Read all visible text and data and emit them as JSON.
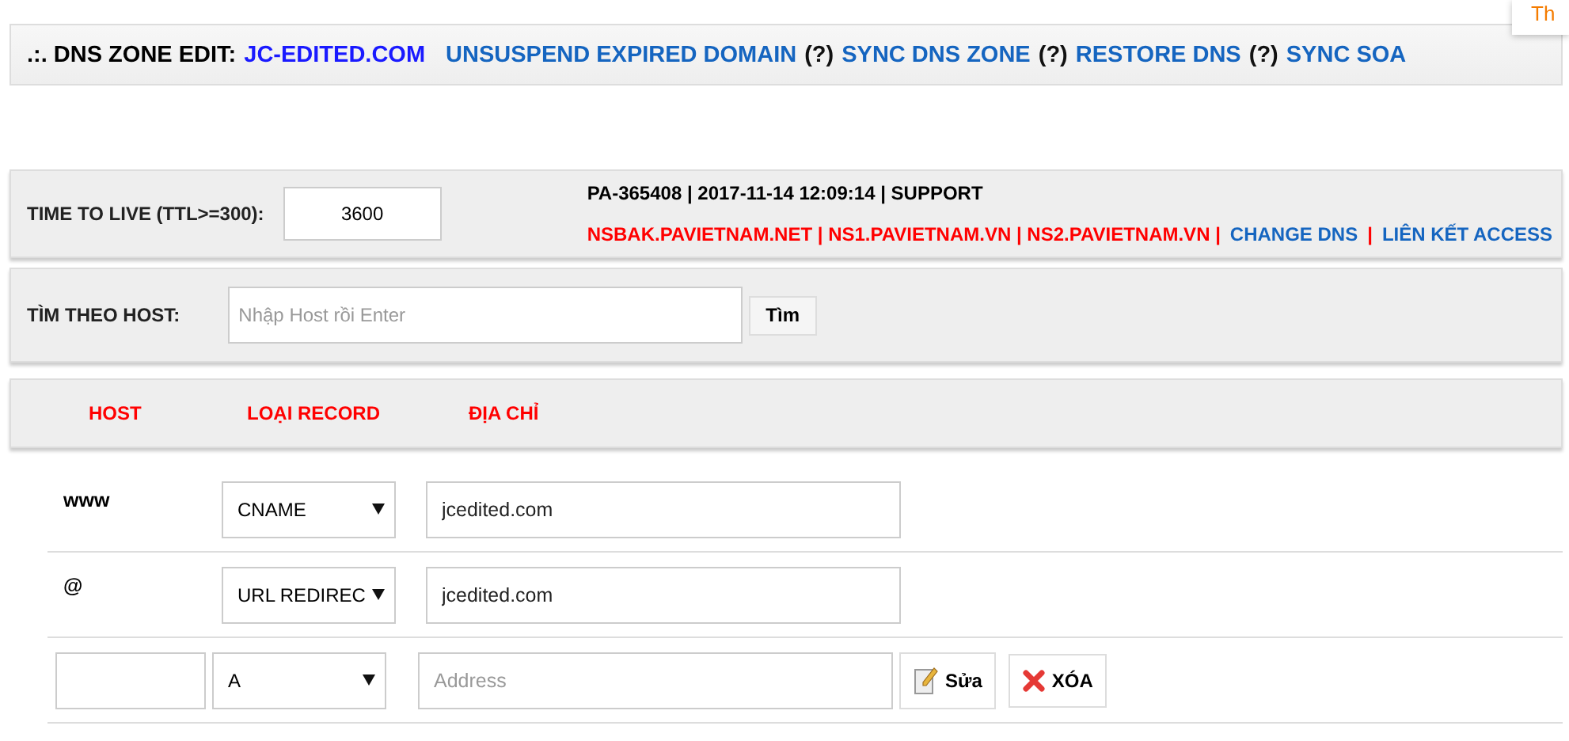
{
  "corner_tab": {
    "label": "Th"
  },
  "header": {
    "prefix": ".:. DNS ZONE EDIT:",
    "domain": "JC-EDITED.COM",
    "items": [
      {
        "kind": "link",
        "text": "UNSUSPEND EXPIRED DOMAIN"
      },
      {
        "kind": "help",
        "text": "(?)"
      },
      {
        "kind": "link",
        "text": "SYNC DNS ZONE"
      },
      {
        "kind": "help",
        "text": "(?)"
      },
      {
        "kind": "link",
        "text": "RESTORE DNS"
      },
      {
        "kind": "help",
        "text": "(?)"
      },
      {
        "kind": "link",
        "text": "SYNC SOA"
      }
    ]
  },
  "ttl": {
    "label": "TIME TO LIVE (TTL>=300):",
    "value": "3600",
    "info": "PA-365408 | 2017-11-14 12:09:14 | SUPPORT",
    "nameservers": "NSBAK.PAVIETNAM.NET | NS1.PAVIETNAM.VN | NS2.PAVIETNAM.VN |",
    "links": [
      {
        "kind": "link",
        "text": "CHANGE DNS"
      },
      {
        "kind": "sep",
        "text": "|"
      },
      {
        "kind": "link",
        "text": "LIÊN KẾT ACCESS"
      }
    ]
  },
  "search": {
    "label": "TÌM THEO HOST:",
    "placeholder": "Nhập Host rồi Enter",
    "button": "Tìm"
  },
  "columns": [
    "HOST",
    "LOẠI RECORD",
    "ĐỊA CHỈ"
  ],
  "records": [
    {
      "kind": "saved",
      "host": "www",
      "type": "CNAME",
      "address": "jcedited.com"
    },
    {
      "kind": "saved",
      "host": "@",
      "type": "URL REDIREC",
      "address": "jcedited.com"
    },
    {
      "kind": "new",
      "type": "A",
      "address_placeholder": "Address",
      "edit_button": "Sửa",
      "delete_button": "XÓA"
    }
  ]
}
